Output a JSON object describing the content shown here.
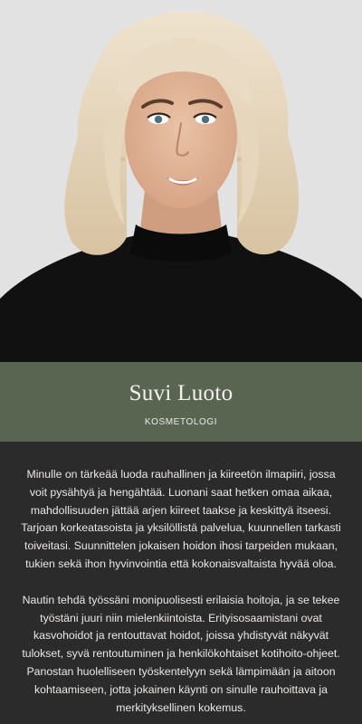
{
  "profile": {
    "photo_alt": "portrait-photo",
    "name": "Suvi Luoto",
    "role": "KOSMETOLOGI"
  },
  "bio": {
    "paragraph_1": "Minulle on tärkeää luoda rauhallinen ja kiireetön ilmapiiri, jossa voit pysähtyä ja hengähtää. Luonani saat hetken omaa aikaa, mahdollisuuden jättää arjen kiireet taakse ja keskittyä itseesi. Tarjoan korkeatasoista ja yksilöllistä palvelua, kuunnellen tarkasti toiveitasi. Suunnittelen jokaisen hoidon ihosi tarpeiden mukaan, tukien sekä ihon hyvinvointia että kokonaisvaltaista hyvää oloa.",
    "paragraph_2": "Nautin tehdä työssäni monipuolisesti erilaisia hoitoja, ja se tekee työstäni juuri niin mielenkiintoista. Erityisosaamistani ovat kasvohoidot ja rentouttavat hoidot, joissa yhdistyvät näkyvät tulokset, syvä rentoutuminen ja henkilökohtaiset kotihoito-ohjeet. Panostan huolelliseen työskentelyyn sekä lämpimään ja aitoon kohtaamiseen, jotta jokainen käynti on sinulle rauhoittava ja merkityksellinen kokemus."
  },
  "colors": {
    "photo_background": "#e2e2e2",
    "name_band": "#5a6551",
    "bio_background": "#2c2b2b",
    "text_light": "#ebe9e6"
  }
}
